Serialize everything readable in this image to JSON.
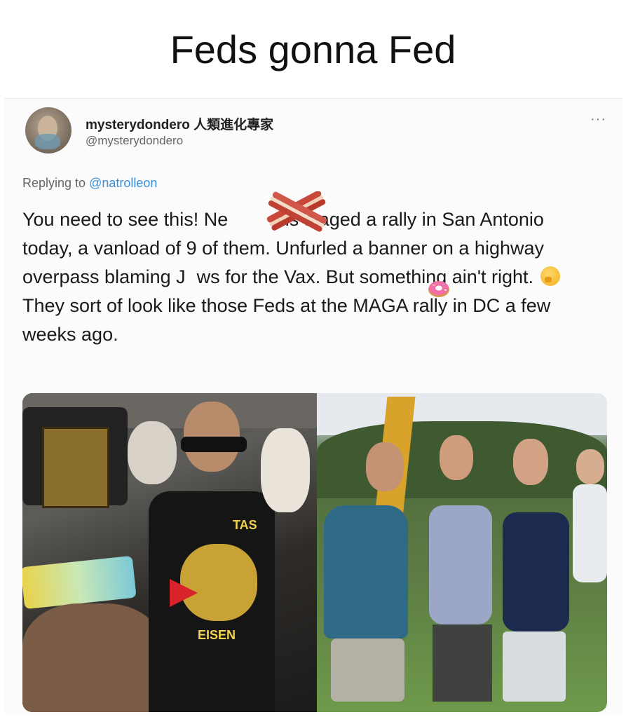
{
  "meme": {
    "title": "Feds gonna Fed"
  },
  "tweet": {
    "display_name": "mysterydondero 人類進化專家",
    "handle": "@mysterydondero",
    "more_label": "···",
    "reply_prefix": "Replying to",
    "reply_mention": "@natrolleon",
    "body_part1": "You need to see this!  Ne",
    "body_part1b": "zis staged a rally in San Antonio today, a vanload of 9 of them.  Unfurled a banner on a highway overpass blaming J",
    "body_part1c": "ws for the Vax.  But something ain't right.",
    "body_part2": "They sort of look like those Feds at the MAGA rally in DC a few weeks ago."
  },
  "photos": {
    "left_shirt_text_top": "TAS",
    "left_shirt_text_bottom": "EISEN"
  },
  "icons": {
    "thinking": "thinking-face-emoji",
    "bacon": "bacon-sticker",
    "donut": "donut-sticker",
    "more": "more-icon"
  }
}
